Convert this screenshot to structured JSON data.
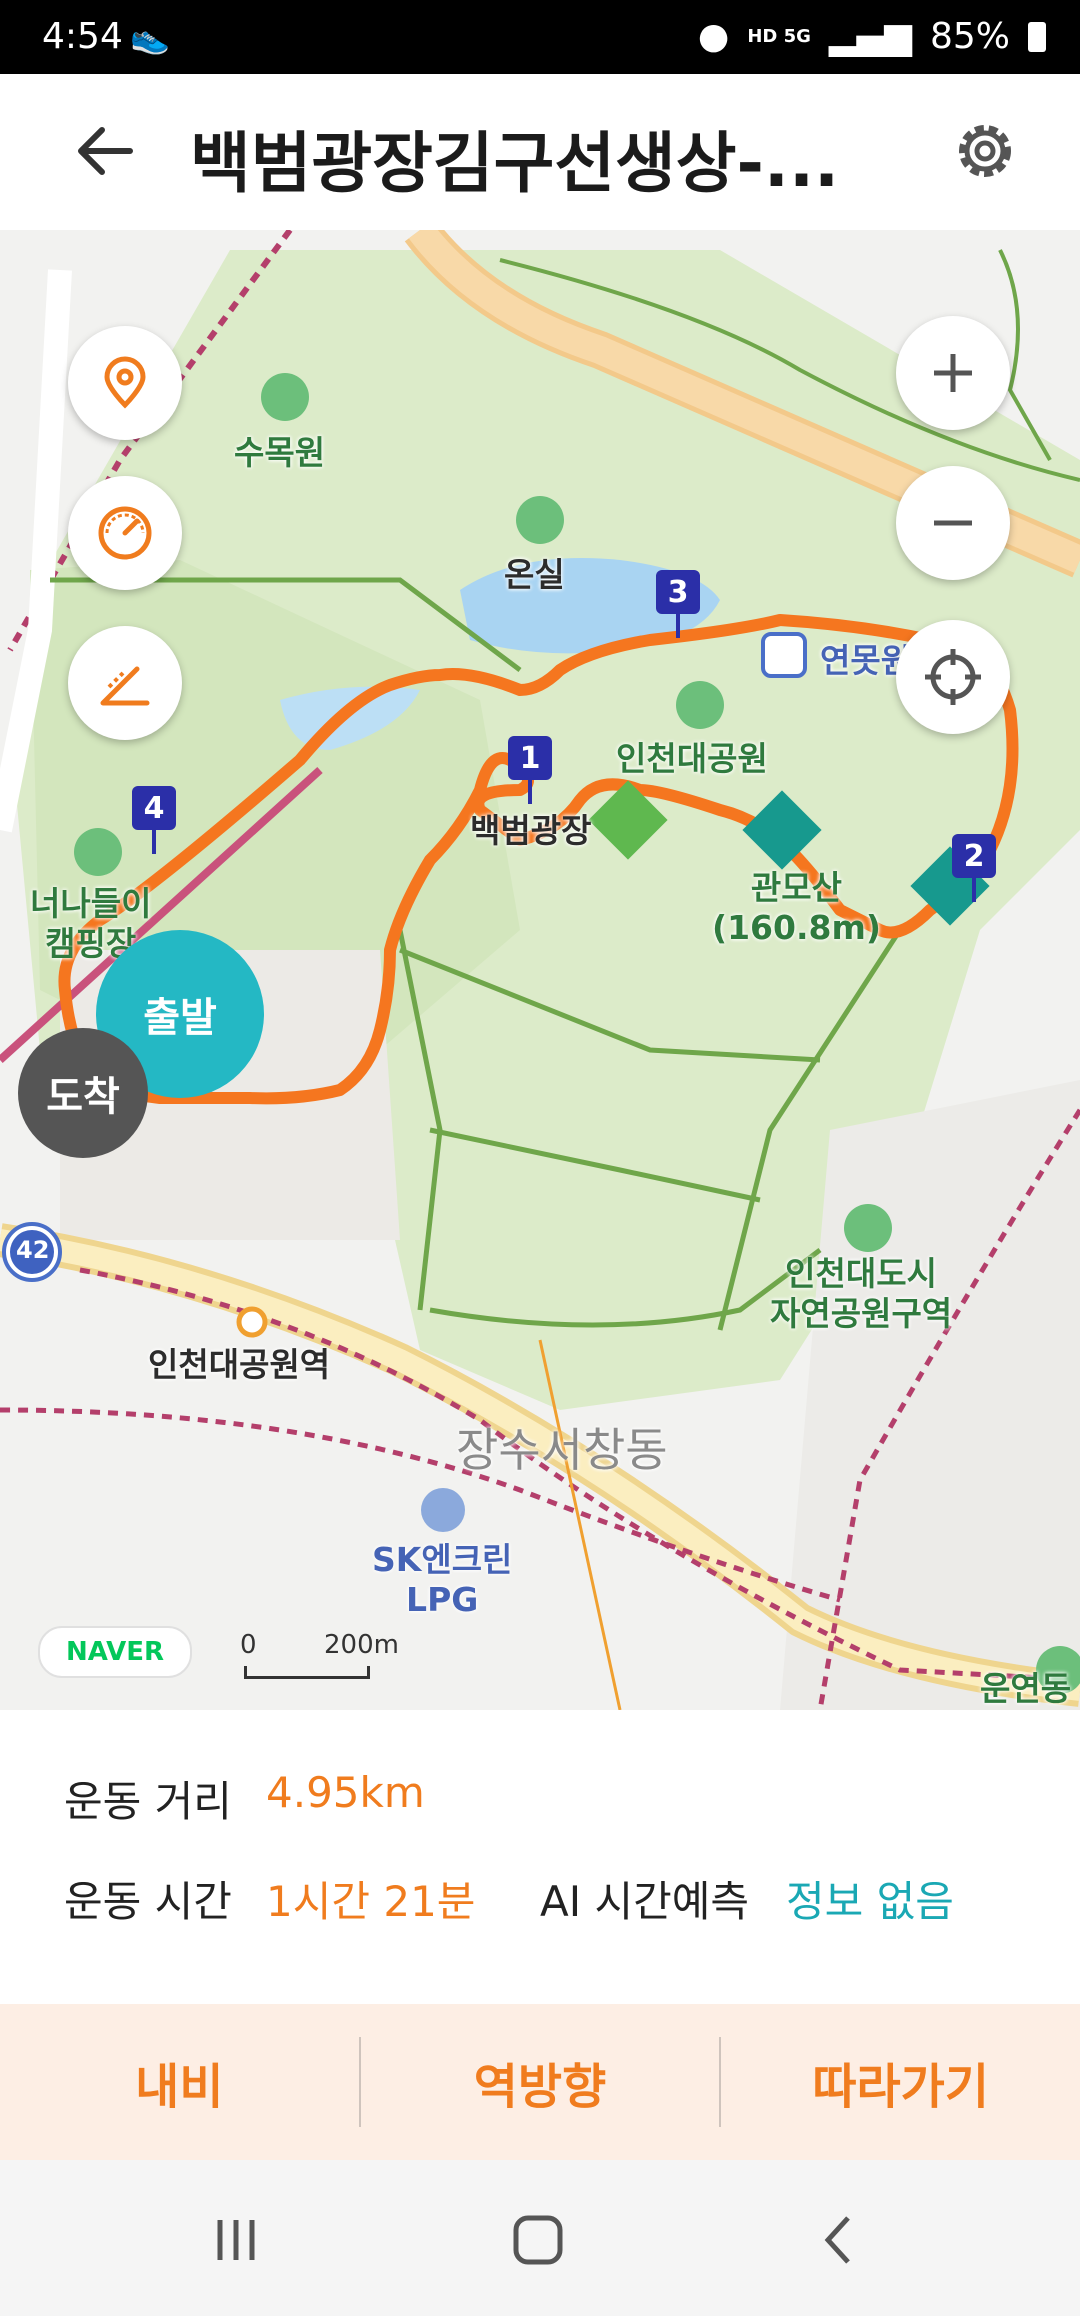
{
  "status_bar": {
    "time": "4:54",
    "network": "HD 5G",
    "battery": "85%"
  },
  "header": {
    "title": "백범광장김구선생상-..."
  },
  "map": {
    "labels": {
      "sumokwon": "수목원",
      "onsil": "온실",
      "yeonmot": "연못원",
      "incheon_park": "인천대공원",
      "baekbeom": "백범광장",
      "gwanmosan": "관모산",
      "gwanmosan_height": "(160.8m)",
      "camping_line1": "너나들이",
      "camping_line2": "캠핑장",
      "station": "인천대공원역",
      "district": "장수서창동",
      "natural_park_line1": "인천대도시",
      "natural_park_line2": "자연공원구역",
      "sk_line1": "SK엔크린",
      "sk_line2": "LPG",
      "road_number": "42",
      "bottom_right": "운연동"
    },
    "markers": [
      "1",
      "2",
      "3",
      "4"
    ],
    "start_label": "출발",
    "end_label": "도착",
    "naver_logo": "NAVER",
    "scale_zero": "0",
    "scale_distance": "200m"
  },
  "info": {
    "distance_label": "운동 거리",
    "distance_value": "4.95km",
    "time_label": "운동 시간",
    "time_value": "1시간 21분",
    "ai_label": "AI 시간예측",
    "ai_value": "정보 없음"
  },
  "actions": {
    "navi": "내비",
    "reverse": "역방향",
    "follow": "따라가기"
  },
  "colors": {
    "route": "#f5761f",
    "accent": "#f07c1e",
    "teal": "#1aa8b4",
    "marker": "#2b2fa8"
  }
}
